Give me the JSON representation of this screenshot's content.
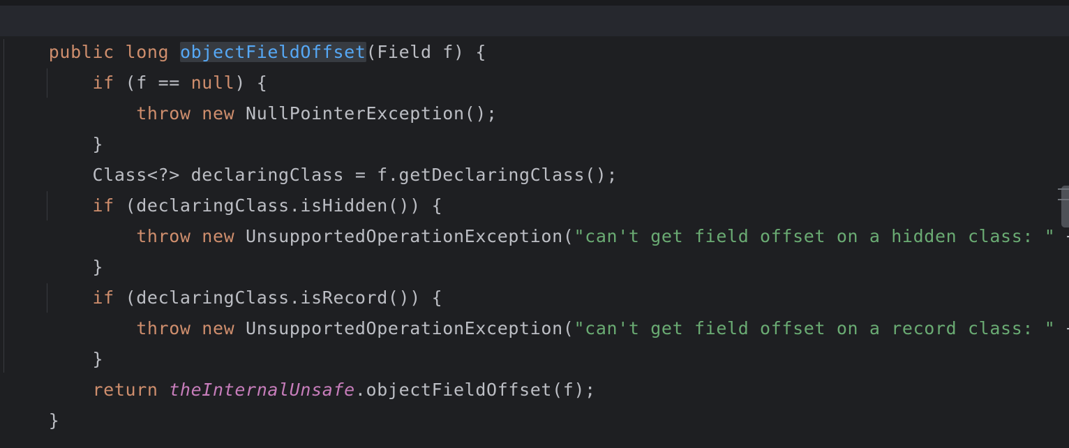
{
  "editor": {
    "lines": [
      {
        "t1": "public",
        "t2": " ",
        "t3": "long",
        "t4": " ",
        "t5": "objectFieldOffset",
        "t6": "(Field f) {"
      },
      {
        "indent": "    ",
        "t1": "if",
        "t2": " (f == ",
        "t3": "null",
        "t4": ") {"
      },
      {
        "indent": "        ",
        "t1": "throw",
        "t2": " ",
        "t3": "new",
        "t4": " NullPointerException();"
      },
      {
        "indent": "    ",
        "t1": "}"
      },
      {
        "indent": "    ",
        "t1": "Class<?> declaringClass = f.getDeclaringClass();"
      },
      {
        "indent": "    ",
        "t1": "if",
        "t2": " (declaringClass.isHidden()) {"
      },
      {
        "indent": "        ",
        "t1": "throw",
        "t2": " ",
        "t3": "new",
        "t4": " UnsupportedOperationException(",
        "t5": "\"can't get field offset on a hidden class: \"",
        "t6": " + f);"
      },
      {
        "indent": "    ",
        "t1": "}"
      },
      {
        "indent": "    ",
        "t1": "if",
        "t2": " (declaringClass.isRecord()) {"
      },
      {
        "indent": "        ",
        "t1": "throw",
        "t2": " ",
        "t3": "new",
        "t4": " UnsupportedOperationException(",
        "t5": "\"can't get field offset on a record class: \"",
        "t6": " + f);"
      },
      {
        "indent": "    ",
        "t1": "}"
      },
      {
        "indent": "    ",
        "t1": "return",
        "t2": " ",
        "t3": "theInternalUnsafe",
        "t4": ".objectFieldOffset(f);"
      },
      {
        "t1": "}"
      }
    ]
  },
  "colors": {
    "background": "#1e1f22",
    "caret_row": "#26282e",
    "keyword": "#cf8e6d",
    "method_declaration": "#56a8f5",
    "string": "#6aab73",
    "static_field": "#c77dbb",
    "default_text": "#bcbec4"
  }
}
